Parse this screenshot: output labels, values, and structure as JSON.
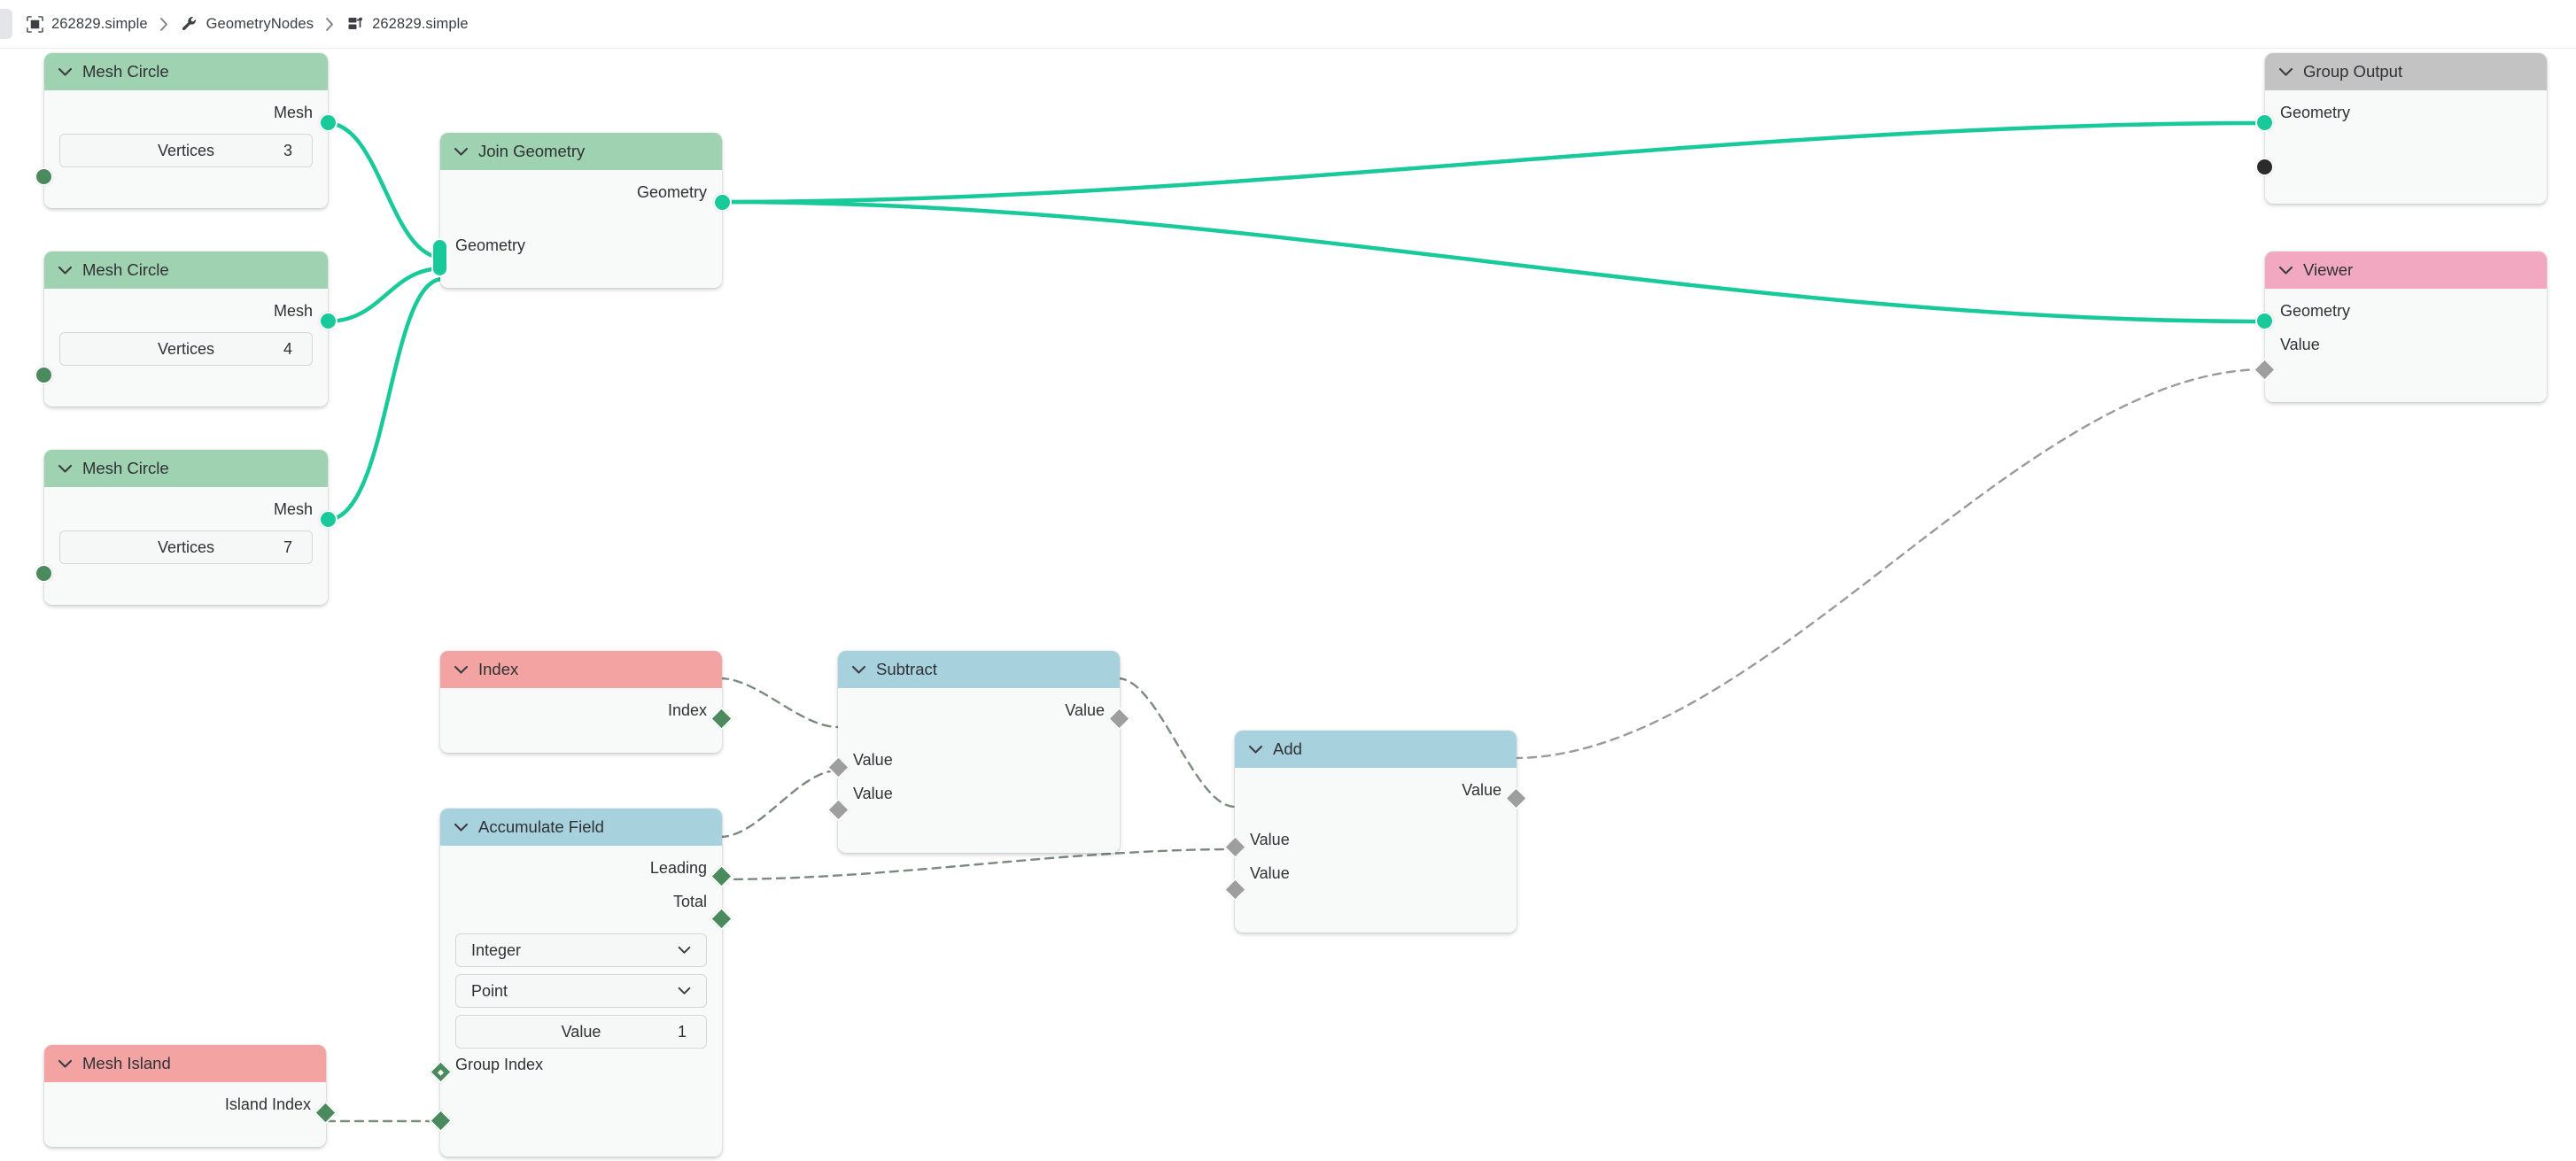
{
  "breadcrumb": {
    "tab_icon": "viewport-icon",
    "items": [
      {
        "label": "262829.simple",
        "icon": "scene-icon"
      },
      {
        "label": "GeometryNodes",
        "icon": "wrench-icon"
      },
      {
        "label": "262829.simple",
        "icon": "nodetree-icon"
      }
    ],
    "separator": "›"
  },
  "colors": {
    "header_geometry": "#9ed2b0",
    "header_input": "#f4a3a3",
    "header_converter": "#a8d1de",
    "header_output": "#c3c3c3",
    "header_viewer": "#f2a8c0",
    "socket_geometry": "#18c99a",
    "socket_field": "#4a8a5c",
    "socket_value": "#9e9e9e",
    "node_body": "#f8f9f9",
    "link_geometry": "#18c99a",
    "link_field": "#7a8a7d"
  },
  "nodes": {
    "mesh_circle_1": {
      "title": "Mesh Circle",
      "outputs": [
        {
          "label": "Mesh",
          "socket": "geometry"
        }
      ],
      "widget": {
        "name": "Vertices",
        "value": "3"
      }
    },
    "mesh_circle_2": {
      "title": "Mesh Circle",
      "outputs": [
        {
          "label": "Mesh",
          "socket": "geometry"
        }
      ],
      "widget": {
        "name": "Vertices",
        "value": "4"
      }
    },
    "mesh_circle_3": {
      "title": "Mesh Circle",
      "outputs": [
        {
          "label": "Mesh",
          "socket": "geometry"
        }
      ],
      "widget": {
        "name": "Vertices",
        "value": "7"
      }
    },
    "join_geometry": {
      "title": "Join Geometry",
      "outputs": [
        {
          "label": "Geometry",
          "socket": "geometry"
        }
      ],
      "inputs": [
        {
          "label": "Geometry",
          "socket": "multi-geometry"
        }
      ]
    },
    "group_output": {
      "title": "Group Output",
      "inputs": [
        {
          "label": "Geometry",
          "socket": "geometry"
        },
        {
          "label": "",
          "socket": "virtual"
        }
      ]
    },
    "viewer": {
      "title": "Viewer",
      "inputs": [
        {
          "label": "Geometry",
          "socket": "geometry"
        },
        {
          "label": "Value",
          "socket": "value"
        }
      ]
    },
    "index": {
      "title": "Index",
      "outputs": [
        {
          "label": "Index",
          "socket": "field"
        }
      ]
    },
    "subtract": {
      "title": "Subtract",
      "outputs": [
        {
          "label": "Value",
          "socket": "value"
        }
      ],
      "inputs": [
        {
          "label": "Value",
          "socket": "value"
        },
        {
          "label": "Value",
          "socket": "value"
        }
      ]
    },
    "add": {
      "title": "Add",
      "outputs": [
        {
          "label": "Value",
          "socket": "value"
        }
      ],
      "inputs": [
        {
          "label": "Value",
          "socket": "value"
        },
        {
          "label": "Value",
          "socket": "value"
        }
      ]
    },
    "accumulate_field": {
      "title": "Accumulate Field",
      "outputs": [
        {
          "label": "Leading",
          "socket": "field"
        },
        {
          "label": "Total",
          "socket": "field"
        }
      ],
      "dropdowns": [
        {
          "value": "Integer"
        },
        {
          "value": "Point"
        }
      ],
      "value_widget": {
        "name": "Value",
        "value": "1"
      },
      "inputs": [
        {
          "label": "Group Index",
          "socket": "field"
        }
      ]
    },
    "mesh_island": {
      "title": "Mesh Island",
      "outputs": [
        {
          "label": "Island Index",
          "socket": "field"
        }
      ]
    }
  },
  "links": [
    {
      "from": "mesh_circle_1.Mesh",
      "to": "join_geometry.Geometry",
      "type": "geometry"
    },
    {
      "from": "mesh_circle_2.Mesh",
      "to": "join_geometry.Geometry",
      "type": "geometry"
    },
    {
      "from": "mesh_circle_3.Mesh",
      "to": "join_geometry.Geometry",
      "type": "geometry"
    },
    {
      "from": "join_geometry.Geometry",
      "to": "group_output.Geometry",
      "type": "geometry"
    },
    {
      "from": "join_geometry.Geometry",
      "to": "viewer.Geometry",
      "type": "geometry"
    },
    {
      "from": "index.Index",
      "to": "subtract.Value1",
      "type": "field"
    },
    {
      "from": "accumulate_field.Leading",
      "to": "subtract.Value2",
      "type": "field"
    },
    {
      "from": "subtract.Value",
      "to": "add.Value1",
      "type": "field"
    },
    {
      "from": "accumulate_field.Total",
      "to": "add.Value2",
      "type": "field"
    },
    {
      "from": "add.Value",
      "to": "viewer.Value",
      "type": "field"
    },
    {
      "from": "mesh_island.Island Index",
      "to": "accumulate_field.Group Index",
      "type": "field"
    }
  ]
}
